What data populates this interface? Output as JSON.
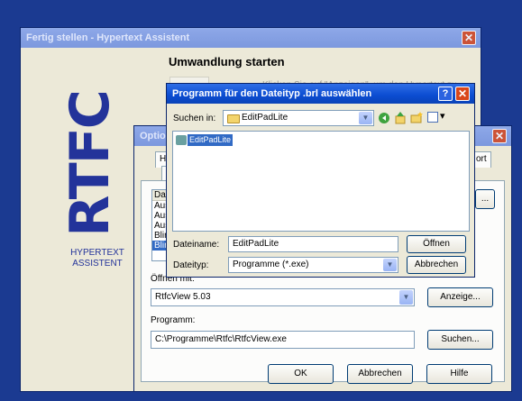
{
  "assistant": {
    "title": "Fertig stellen - Hypertext Assistent",
    "heading": "Umwandlung starten",
    "hint": "Klicken Sie auf \"Anzeigen\", um den Hypertext zu",
    "logo_text": "RTFC",
    "brand_line1": "HYPERTEXT",
    "brand_line2": "ASSISTENT",
    "close_glyph": "✕"
  },
  "options": {
    "title": "Optionen",
    "tabs": [
      "HT",
      "A",
      "ort"
    ],
    "list_header": "Da",
    "list_items": [
      "Aus",
      "Aus",
      "Aus",
      "Blir",
      "Blir"
    ],
    "side_button": "...",
    "viewer_label": "Öffnen mit:",
    "viewer_value": "RtfcView 5.03",
    "show_button": "Anzeige...",
    "program_label": "Programm:",
    "program_value": "C:\\Programme\\Rtfc\\RtfcView.exe",
    "search_button": "Suchen...",
    "ok_button": "OK",
    "cancel_button": "Abbrechen",
    "help_button": "Hilfe",
    "close_glyph": "✕"
  },
  "filedialog": {
    "title": "Programm für den Dateityp .brl auswählen",
    "help_glyph": "?",
    "close_glyph": "✕",
    "lookin_label": "Suchen in:",
    "lookin_value": "EditPadLite",
    "file_item": "EditPadLite",
    "filename_label": "Dateiname:",
    "filename_value": "EditPadLite",
    "filetype_label": "Dateityp:",
    "filetype_value": "Programme (*.exe)",
    "open_button": "Öffnen",
    "cancel_button": "Abbrechen",
    "dropdown_glyph": "▼",
    "view_menu_glyph": "▾"
  },
  "colors": {
    "desktop": "#1b3a91",
    "logo_blue": "#23339a",
    "titlebar": "#0b4cd1",
    "close_red": "#d9471b"
  }
}
